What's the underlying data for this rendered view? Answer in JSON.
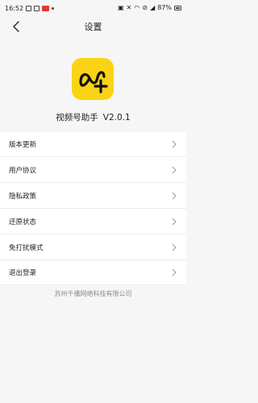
{
  "status_bar": {
    "time": "16:52",
    "battery_percent": "87%",
    "left_icons": [
      "photo-icon",
      "notification-icon",
      "red-app-icon",
      "dot-icon"
    ],
    "right_icons": [
      "nfc-icon",
      "mute-icon",
      "wifi-icon",
      "dnd-icon",
      "signal-icon",
      "battery-icon"
    ]
  },
  "nav": {
    "title": "设置",
    "back_icon": "back-chevron-icon"
  },
  "app": {
    "logo_color": "#fad414",
    "name": "视频号助手",
    "version": "V2.0.1"
  },
  "menu": {
    "items": [
      {
        "label": "版本更新"
      },
      {
        "label": "用户协议"
      },
      {
        "label": "隐私政策"
      },
      {
        "label": "还原状态"
      },
      {
        "label": "免打扰模式"
      },
      {
        "label": "退出登录"
      }
    ]
  },
  "footer": {
    "company": "苏州千播网络科技有限公司"
  }
}
